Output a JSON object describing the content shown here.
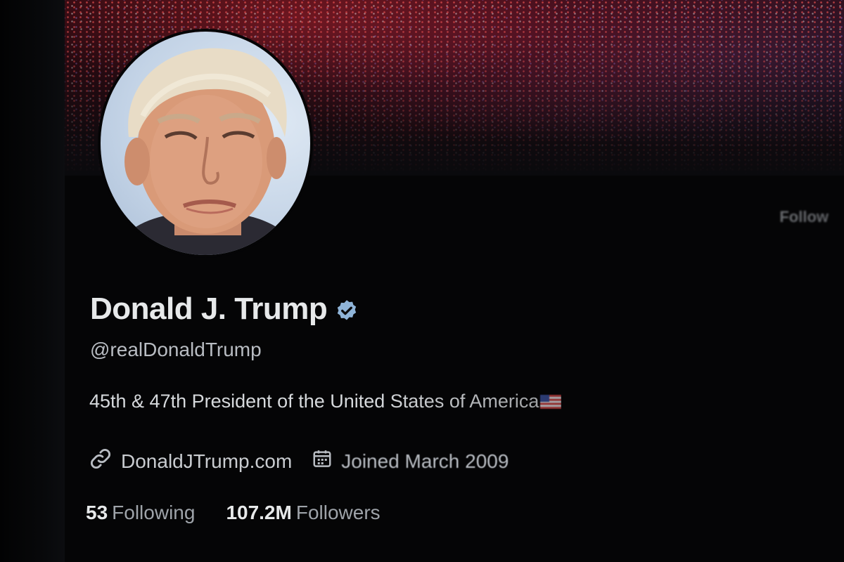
{
  "profile": {
    "display_name": "Donald J. Trump",
    "handle": "@realDonaldTrump",
    "bio": "45th & 47th President of the United States of America",
    "website": "DonaldJTrump.com",
    "joined": "Joined March 2009",
    "following_count": "53",
    "following_label": "Following",
    "followers_count": "107.2M",
    "followers_label": "Followers",
    "verified": true
  },
  "actions": {
    "follow_label": "Follow"
  },
  "icons": {
    "verified": "verified-badge-icon",
    "link": "link-icon",
    "calendar": "calendar-icon",
    "flag": "us-flag-emoji"
  },
  "colors": {
    "background": "#050506",
    "primary_text": "#e7e9ea",
    "secondary_text": "#b8bcc2",
    "verified_badge": "#8fb4d8"
  }
}
